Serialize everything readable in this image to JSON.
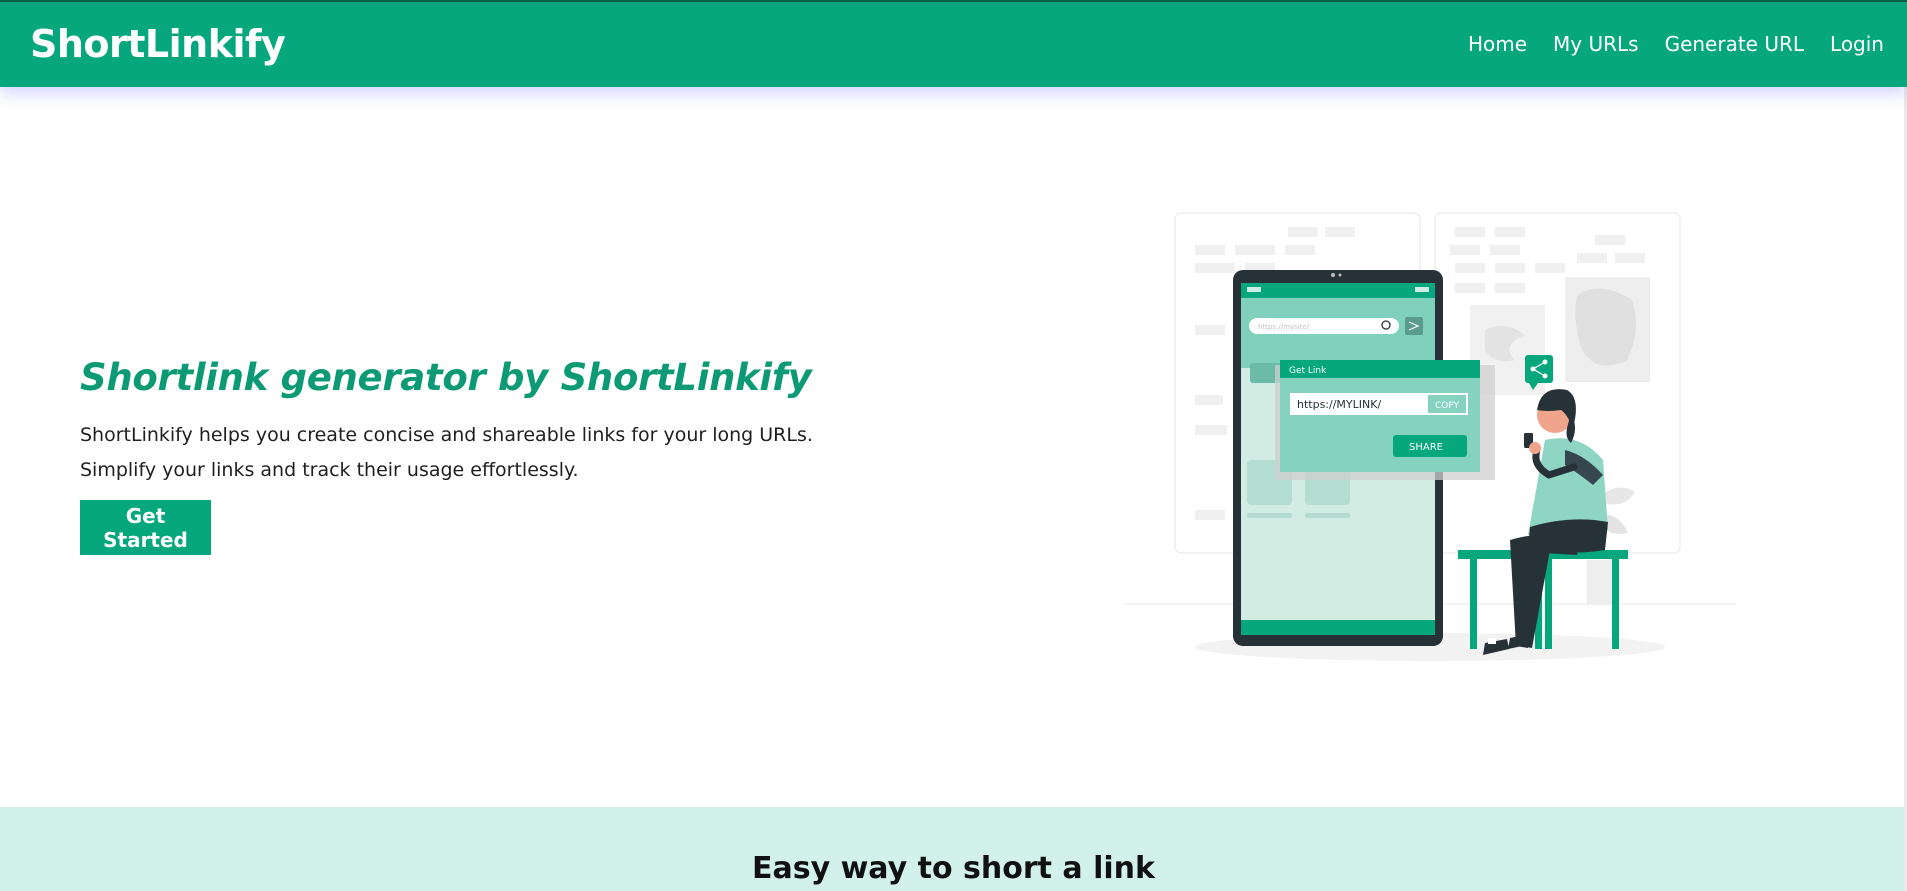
{
  "navbar": {
    "brand": "ShortLinkify",
    "links": [
      "Home",
      "My URLs",
      "Generate URL",
      "Login"
    ]
  },
  "hero": {
    "title": "Shortlink generator by ShortLinkify",
    "description": "ShortLinkify helps you create concise and shareable links for your long URLs. Simplify your links and track their usage effortlessly.",
    "cta_label": "Get Started"
  },
  "illustration": {
    "search_placeholder": "https://mysite/",
    "panel_title": "Get Link",
    "link_value": "https://MYLINK/",
    "copy_label": "COPY",
    "share_label": "SHARE"
  },
  "section2": {
    "title": "Easy way to short a link"
  },
  "colors": {
    "primary": "#06a77d",
    "title_green": "#0b9a74",
    "light_mint": "#d2f1ea",
    "phone_dark": "#263238"
  }
}
